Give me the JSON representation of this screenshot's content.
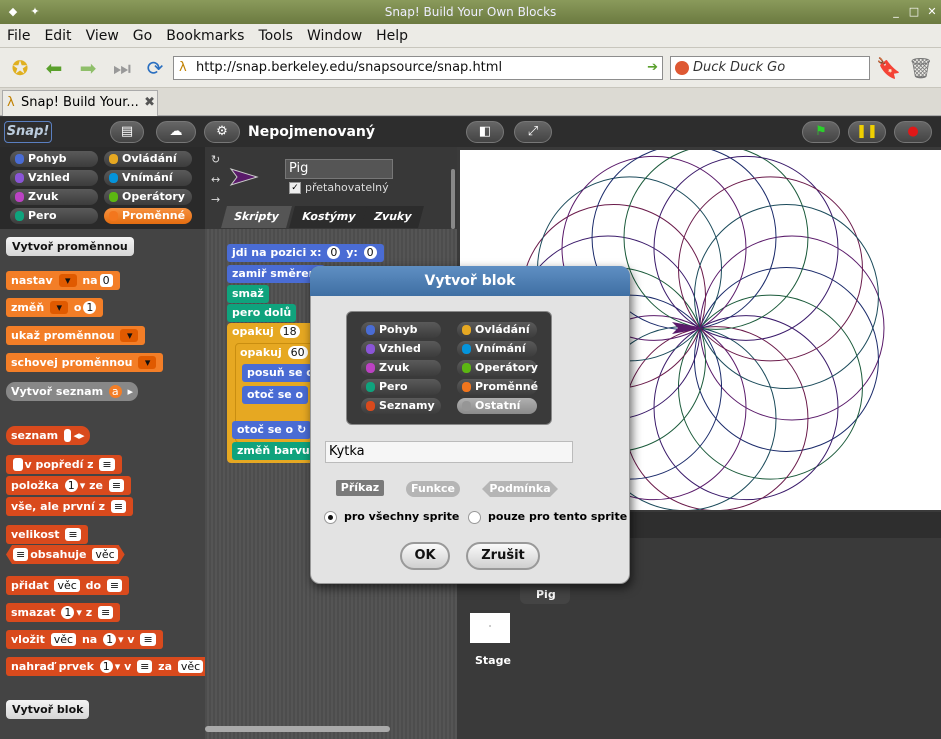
{
  "window": {
    "title": "Snap! Build Your Own Blocks"
  },
  "menu": [
    "File",
    "Edit",
    "View",
    "Go",
    "Bookmarks",
    "Tools",
    "Window",
    "Help"
  ],
  "nav": {
    "url": "http://snap.berkeley.edu/snapsource/snap.html",
    "search_placeholder": "Duck Duck Go"
  },
  "tab": {
    "label": "Snap! Build Your..."
  },
  "snap": {
    "logo": "Snap!",
    "project_name": "Nepojmenovaný",
    "categories": [
      "Pohyb",
      "Ovládání",
      "Vzhled",
      "Vnímání",
      "Zvuk",
      "Operátory",
      "Pero",
      "Proměnné"
    ],
    "category_colors": [
      "#4a6cd4",
      "#e6a822",
      "#8a55d7",
      "#0494dc",
      "#bb42c3",
      "#5cb712",
      "#0fa37d",
      "#f3761d"
    ],
    "palette": {
      "make_variable": "Vytvoř proměnnou",
      "set": "nastav",
      "set_to": "na",
      "set_value": "0",
      "change": "změň",
      "change_by": "o",
      "change_value": "1",
      "show_var": "ukaž proměnnou",
      "hide_var": "schovej proměnnou",
      "make_list": "Vytvoř seznam",
      "make_list_slot": "a",
      "list_label": "seznam",
      "in_front_of": "v popředí z",
      "item": "položka",
      "item_value": "1",
      "item_of": "ze",
      "all_but_first": "vše, ale první z",
      "length": "velikost",
      "contains": "obsahuje",
      "contains_value": "věc",
      "add": "přidat",
      "add_value": "věc",
      "add_to": "do",
      "delete": "smazat",
      "delete_value": "1",
      "delete_of": "z",
      "insert": "vložit",
      "insert_value": "věc",
      "insert_at": "na",
      "insert_index": "1",
      "insert_of": "v",
      "replace": "nahraď prvek",
      "replace_index": "1",
      "replace_of": "v",
      "replace_with": "za",
      "replace_value": "věc",
      "make_block": "Vytvoř blok"
    },
    "sprite": {
      "name": "Pig",
      "draggable_label": "přetahovatelný"
    },
    "tabs": [
      "Skripty",
      "Kostýmy",
      "Zvuky"
    ],
    "script": {
      "goto": "jdi na pozici x:",
      "goto_x": "0",
      "goto_y_label": "y:",
      "goto_y": "0",
      "point": "zamiř směrem",
      "clear": "smaž",
      "pen_down": "pero dolů",
      "repeat": "opakuj",
      "repeat_n": "18",
      "repeat2": "opakuj",
      "repeat2_n": "60",
      "move": "posuň se o",
      "turn": "otoč se o",
      "turn2": "otoč se o",
      "change_color": "změň barvu"
    },
    "corral": {
      "sprite": "Pig",
      "stage": "Stage"
    }
  },
  "dialog": {
    "title": "Vytvoř blok",
    "categories": [
      "Pohyb",
      "Ovládání",
      "Vzhled",
      "Vnímání",
      "Zvuk",
      "Operátory",
      "Pero",
      "Proměnné",
      "Seznamy",
      "Ostatní"
    ],
    "category_colors": [
      "#4a6cd4",
      "#e6a822",
      "#8a55d7",
      "#0494dc",
      "#bb42c3",
      "#5cb712",
      "#0fa37d",
      "#f3761d",
      "#d94a1d",
      "#969696"
    ],
    "input_value": "Kytka",
    "shapes": [
      "Příkaz",
      "Funkce",
      "Podmínka"
    ],
    "radio_all": "pro všechny sprite",
    "radio_this": "pouze pro tento sprite",
    "ok": "OK",
    "cancel": "Zrušit"
  }
}
